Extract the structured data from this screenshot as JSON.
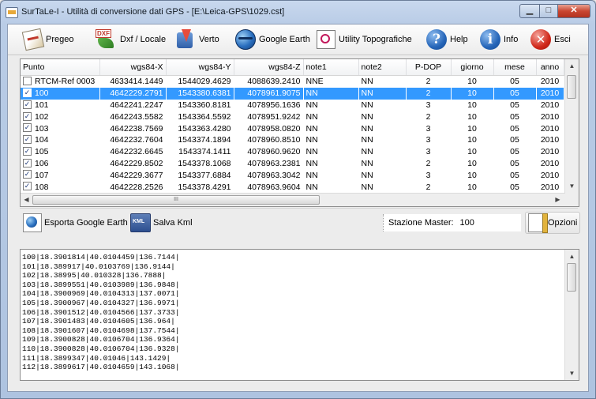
{
  "window": {
    "title": "SurTaLe-I - Utilità di conversione dati GPS - [E:\\Leica-GPS\\1029.cst]"
  },
  "titlebar_buttons": {
    "minimize": "▁",
    "maximize": "□",
    "close": "✕"
  },
  "toolbar": {
    "pregeo": "Pregeo",
    "dxf_tag": "DXF",
    "dxf": "Dxf / Locale",
    "verto": "Verto",
    "google_earth": "Google Earth",
    "utility": "Utility Topografiche",
    "help": "Help",
    "info": "Info",
    "exit": "Esci"
  },
  "icons": {
    "help_glyph": "?",
    "info_glyph": "i",
    "exit_glyph": "✕",
    "check_glyph": "✓"
  },
  "grid": {
    "columns": [
      "Punto",
      "wgs84-X",
      "wgs84-Y",
      "wgs84-Z",
      "note1",
      "note2",
      "P-DOP",
      "giorno",
      "mese",
      "anno"
    ],
    "selected_index": 1,
    "rows": [
      {
        "checked": false,
        "punto": "RTCM-Ref 0003",
        "x": "4633414.1449",
        "y": "1544029.4629",
        "z": "4088639.2410",
        "note1": "NNE",
        "note2": "NN",
        "pdop": "2",
        "giorno": "10",
        "mese": "05",
        "anno": "2010"
      },
      {
        "checked": true,
        "punto": "100",
        "x": "4642229.2791",
        "y": "1543380.6381",
        "z": "4078961.9075",
        "note1": "NN",
        "note2": "NN",
        "pdop": "2",
        "giorno": "10",
        "mese": "05",
        "anno": "2010"
      },
      {
        "checked": true,
        "punto": "101",
        "x": "4642241.2247",
        "y": "1543360.8181",
        "z": "4078956.1636",
        "note1": "NN",
        "note2": "NN",
        "pdop": "3",
        "giorno": "10",
        "mese": "05",
        "anno": "2010"
      },
      {
        "checked": true,
        "punto": "102",
        "x": "4642243.5582",
        "y": "1543364.5592",
        "z": "4078951.9242",
        "note1": "NN",
        "note2": "NN",
        "pdop": "2",
        "giorno": "10",
        "mese": "05",
        "anno": "2010"
      },
      {
        "checked": true,
        "punto": "103",
        "x": "4642238.7569",
        "y": "1543363.4280",
        "z": "4078958.0820",
        "note1": "NN",
        "note2": "NN",
        "pdop": "3",
        "giorno": "10",
        "mese": "05",
        "anno": "2010"
      },
      {
        "checked": true,
        "punto": "104",
        "x": "4642232.7604",
        "y": "1543374.1894",
        "z": "4078960.8510",
        "note1": "NN",
        "note2": "NN",
        "pdop": "3",
        "giorno": "10",
        "mese": "05",
        "anno": "2010"
      },
      {
        "checked": true,
        "punto": "105",
        "x": "4642232.6645",
        "y": "1543374.1411",
        "z": "4078960.9620",
        "note1": "NN",
        "note2": "NN",
        "pdop": "3",
        "giorno": "10",
        "mese": "05",
        "anno": "2010"
      },
      {
        "checked": true,
        "punto": "106",
        "x": "4642229.8502",
        "y": "1543378.1068",
        "z": "4078963.2381",
        "note1": "NN",
        "note2": "NN",
        "pdop": "2",
        "giorno": "10",
        "mese": "05",
        "anno": "2010"
      },
      {
        "checked": true,
        "punto": "107",
        "x": "4642229.3677",
        "y": "1543377.6884",
        "z": "4078963.3042",
        "note1": "NN",
        "note2": "NN",
        "pdop": "3",
        "giorno": "10",
        "mese": "05",
        "anno": "2010"
      },
      {
        "checked": true,
        "punto": "108",
        "x": "4642228.2526",
        "y": "1543378.4291",
        "z": "4078963.9604",
        "note1": "NN",
        "note2": "NN",
        "pdop": "2",
        "giorno": "10",
        "mese": "05",
        "anno": "2010"
      }
    ]
  },
  "scrollbars": {
    "up": "▲",
    "down": "▼",
    "left": "◀",
    "right": "▶",
    "grip": "III"
  },
  "actions": {
    "export_ge": "Esporta Google Earth",
    "save_kml": "Salva Kml",
    "kml_tag": "KML",
    "master_label": "Stazione Master:",
    "master_value": "100",
    "options": "Opzioni"
  },
  "output": {
    "lines": [
      "100|18.3901814|40.0104459|136.7144|",
      "101|18.389917|40.0103769|136.9144|",
      "102|18.38995|40.010328|136.7888|",
      "103|18.3899551|40.0103989|136.9848|",
      "104|18.3900969|40.0104313|137.0071|",
      "105|18.3900967|40.0104327|136.9971|",
      "106|18.3901512|40.0104566|137.3733|",
      "107|18.3901483|40.0104605|136.964|",
      "108|18.3901607|40.0104698|137.7544|",
      "109|18.3900828|40.0106704|136.9364|",
      "110|18.3900828|40.0106704|136.9328|",
      "111|18.3899347|40.01046|143.1429|",
      "112|18.3899617|40.0104659|143.1068|"
    ]
  }
}
